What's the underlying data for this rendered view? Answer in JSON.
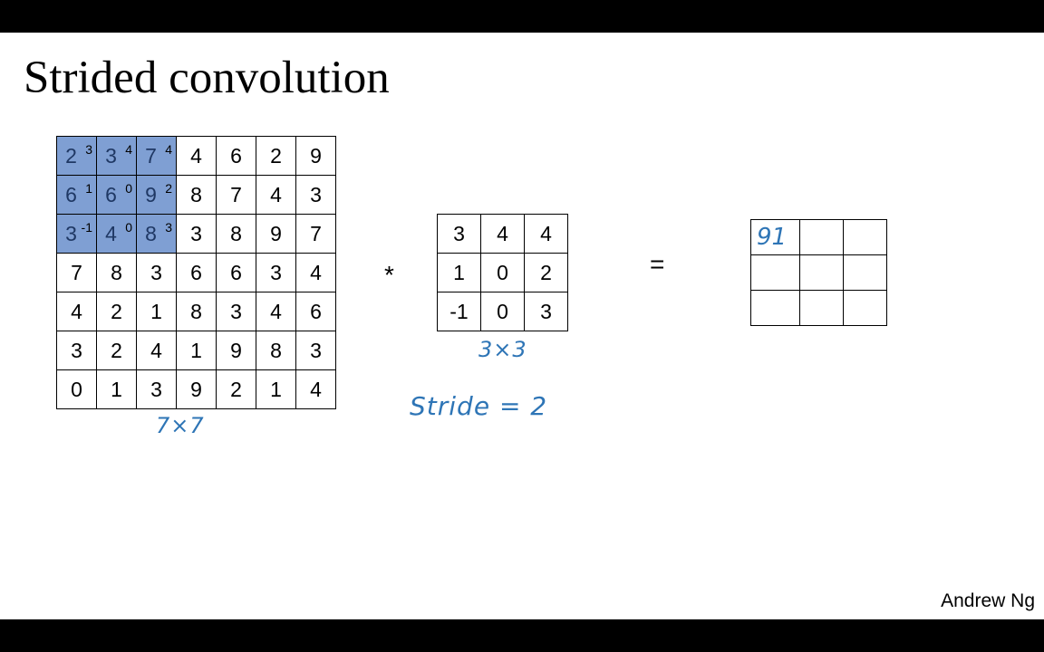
{
  "title": "Strided convolution",
  "operators": {
    "convolve": "*",
    "equals": "="
  },
  "input_matrix": {
    "label": "7×7",
    "rows": [
      [
        "2",
        "3",
        "7",
        "4",
        "6",
        "2",
        "9"
      ],
      [
        "6",
        "6",
        "9",
        "8",
        "7",
        "4",
        "3"
      ],
      [
        "3",
        "4",
        "8",
        "3",
        "8",
        "9",
        "7"
      ],
      [
        "7",
        "8",
        "3",
        "6",
        "6",
        "3",
        "4"
      ],
      [
        "4",
        "2",
        "1",
        "8",
        "3",
        "4",
        "6"
      ],
      [
        "3",
        "2",
        "4",
        "1",
        "9",
        "8",
        "3"
      ],
      [
        "0",
        "1",
        "3",
        "9",
        "2",
        "1",
        "4"
      ]
    ],
    "overlay_weights": [
      [
        "3",
        "4",
        "4"
      ],
      [
        "1",
        "0",
        "2"
      ],
      [
        "-1",
        "0",
        "3"
      ]
    ],
    "highlight_color": "#7f9fd3"
  },
  "filter_matrix": {
    "label": "3×3",
    "rows": [
      [
        "3",
        "4",
        "4"
      ],
      [
        "1",
        "0",
        "2"
      ],
      [
        "-1",
        "0",
        "3"
      ]
    ]
  },
  "stride_note": "Stride = 2",
  "output_matrix": {
    "rows": [
      [
        "91",
        "",
        ""
      ],
      [
        "",
        "",
        ""
      ],
      [
        "",
        "",
        ""
      ]
    ]
  },
  "annotation_color": "#2e75b6",
  "author": "Andrew Ng"
}
